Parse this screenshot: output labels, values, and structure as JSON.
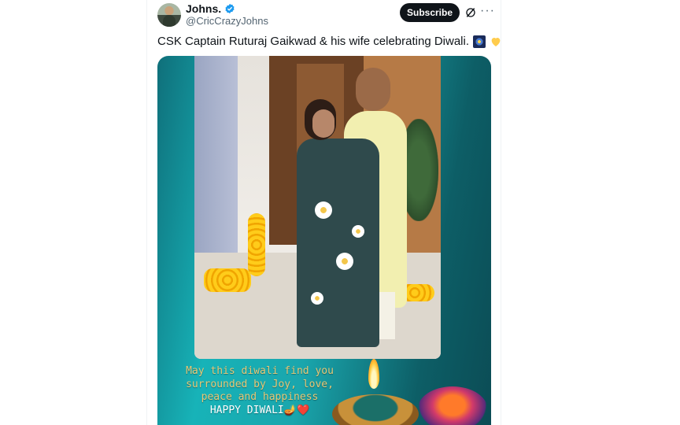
{
  "post": {
    "author": {
      "name": "Johns.",
      "handle": "@CricCrazyJohns",
      "verified": true,
      "verified_icon": "verified-badge-icon",
      "avatar_icon": "avatar"
    },
    "actions": {
      "subscribe_label": "Subscribe",
      "grok_icon": "grok-icon",
      "more_icon": "more-icon",
      "more_glyph": "···"
    },
    "text": "CSK Captain Ruturaj Gaikwad & his wife celebrating Diwali.",
    "emojis": [
      "firework-icon",
      "yellow-heart-icon"
    ],
    "media": {
      "greeting_lines": [
        "May this diwali find you",
        "surrounded by Joy, love,",
        "peace and happiness",
        "HAPPY DIWALI🪔❤️"
      ]
    }
  },
  "colors": {
    "subscribe_bg": "#0f1419",
    "verified_blue": "#1d9bf0",
    "handle_gray": "#536471",
    "media_teal": "#17b3b8",
    "greeting_gold": "#e7c877"
  }
}
